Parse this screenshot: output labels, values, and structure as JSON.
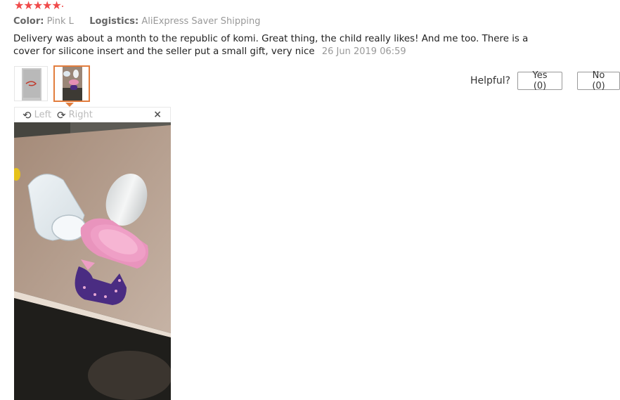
{
  "rating": {
    "stars": 5,
    "icon": "star-icon",
    "color": "#f04a4a"
  },
  "meta": {
    "color_label": "Color:",
    "color_value": "Pink L",
    "logistics_label": "Logistics:",
    "logistics_value": "AliExpress Saver Shipping"
  },
  "review": {
    "text": "Delivery was about a month to the republic of komi. Great thing, the child really likes! And me too. There is a cover for silicone insert and the seller put a small gift, very nice",
    "date": "26 Jun 2019 06:59"
  },
  "thumbnails": [
    {
      "name": "thumbnail-1",
      "active": false
    },
    {
      "name": "thumbnail-2",
      "active": true
    }
  ],
  "helpful": {
    "question": "Helpful?",
    "yes_label": "Yes (0)",
    "no_label": "No (0)"
  },
  "viewer": {
    "rotate_left_label": "Left",
    "rotate_right_label": "Right",
    "rotate_left_icon": "rotate-left-icon",
    "rotate_right_icon": "rotate-right-icon",
    "close_icon": "close-icon",
    "close_glyph": "×"
  },
  "colors": {
    "accent": "#e27d3d",
    "star": "#f04a4a"
  }
}
